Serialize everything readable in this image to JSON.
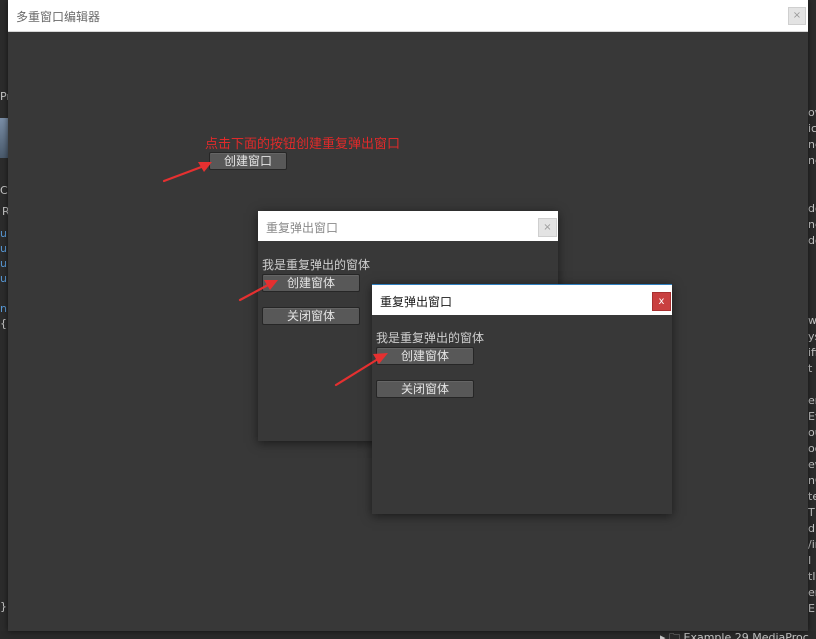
{
  "main_window": {
    "title": "多重窗口编辑器",
    "close_glyph": "×",
    "hint": "点击下面的按钮创建重复弹出窗口",
    "create_window_button": "创建窗口"
  },
  "popups": [
    {
      "title": "重复弹出窗口",
      "close_glyph": "×",
      "message": "我是重复弹出的窗体",
      "create_button": "创建窗体",
      "close_button": "关闭窗体"
    },
    {
      "title": "重复弹出窗口",
      "close_glyph": "x",
      "message": "我是重复弹出的窗体",
      "create_button": "创建窗体",
      "close_button": "关闭窗体"
    }
  ],
  "background": {
    "left_fragments": [
      "Pr",
      "Co",
      "R",
      "u",
      "u",
      "u",
      "u",
      "n",
      "{",
      "}"
    ],
    "right_fragments": [
      "ow",
      "ic",
      "nc",
      "nc",
      "do",
      "ne",
      "do",
      "w",
      "ys",
      "ifi",
      "t",
      "en",
      "Ev",
      "ou",
      "oo",
      "ew",
      "nC",
      "te",
      "T",
      "dl",
      "/ir",
      "I",
      "tl",
      "er",
      "E"
    ],
    "bottom_fragment": "▸ 🗀 Example 29 MediaProc"
  },
  "colors": {
    "hint_red": "#e02a2a",
    "arrow_red": "#e53030",
    "popup_close_red": "#c94040",
    "focus_border_blue": "#2f7fbf"
  },
  "icons": {
    "close": "close-icon",
    "arrow": "red-arrow-annotation"
  }
}
